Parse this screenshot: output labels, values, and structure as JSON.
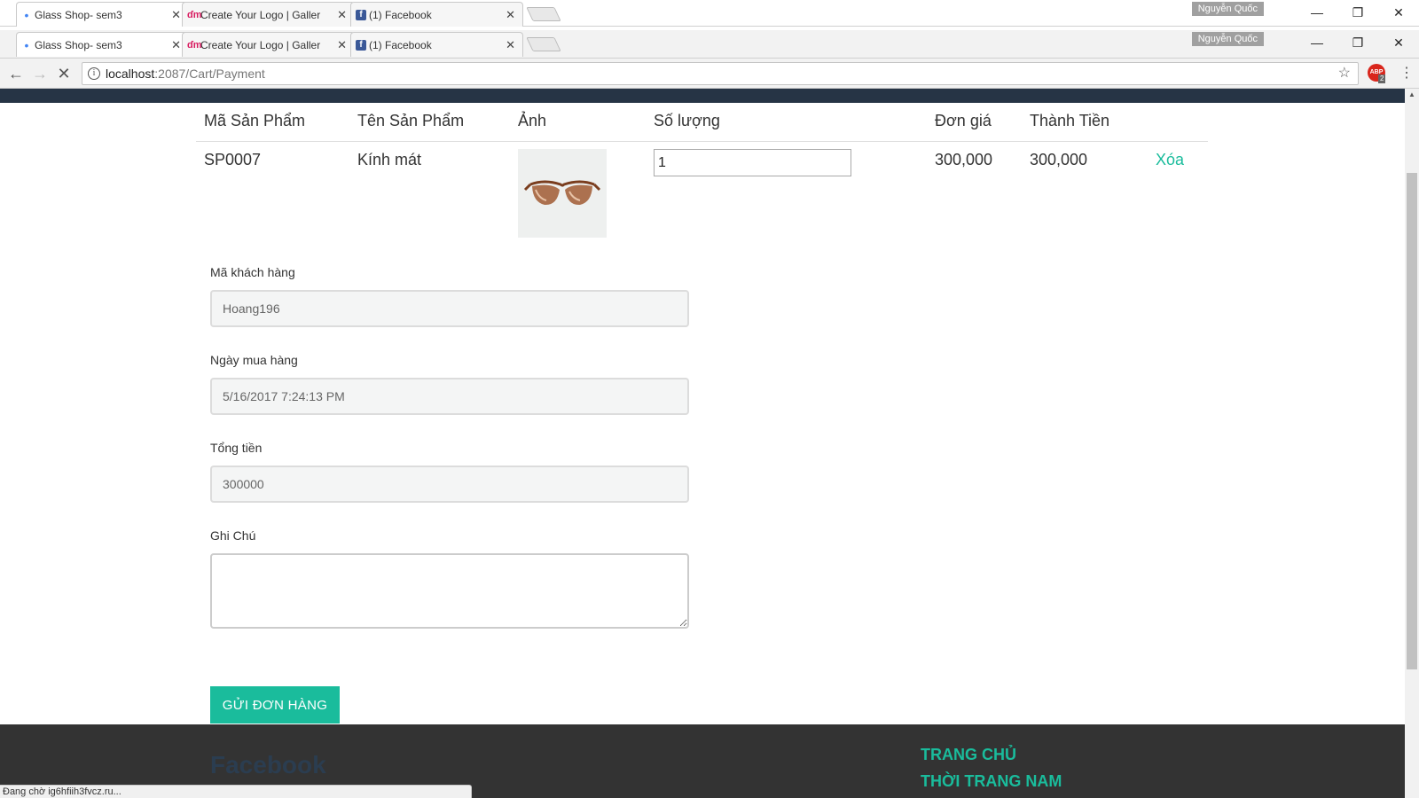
{
  "browser": {
    "tabs": [
      {
        "title": "Glass Shop- sem3",
        "favicon": "loading-dot-icon"
      },
      {
        "title": "Create Your Logo | Galler",
        "favicon": "dm-logo-icon"
      },
      {
        "title": "(1) Facebook",
        "favicon": "facebook-icon"
      }
    ],
    "profile_name": "Nguyễn Quốc",
    "url_host": "localhost",
    "url_path": ":2087/Cart/Payment",
    "abp_label": "ABP",
    "abp_count": "2",
    "status_text": "Đang chờ ig6hfiih3fvcz.ru..."
  },
  "cart": {
    "headers": {
      "code": "Mã Sản Phẩm",
      "name": "Tên Sản Phẩm",
      "image": "Ảnh",
      "qty": "Số lượng",
      "price": "Đơn giá",
      "total": "Thành Tiền"
    },
    "rows": [
      {
        "code": "SP0007",
        "name": "Kính mát",
        "qty": "1",
        "price": "300,000",
        "total": "300,000",
        "delete": "Xóa"
      }
    ]
  },
  "form": {
    "customer_label": "Mã khách hàng",
    "customer_value": "Hoang196",
    "date_label": "Ngày mua hàng",
    "date_value": "5/16/2017 7:24:13 PM",
    "total_label": "Tổng tiền",
    "total_value": "300000",
    "note_label": "Ghi Chú",
    "note_value": "",
    "submit_label": "GỬI ĐƠN HÀNG"
  },
  "footer": {
    "facebook": "Facebook",
    "links": [
      "TRANG CHỦ",
      "THỜI TRANG NAM"
    ]
  },
  "colors": {
    "accent": "#1abc9c",
    "header_bar": "#263445",
    "footer_bg": "#333333"
  }
}
